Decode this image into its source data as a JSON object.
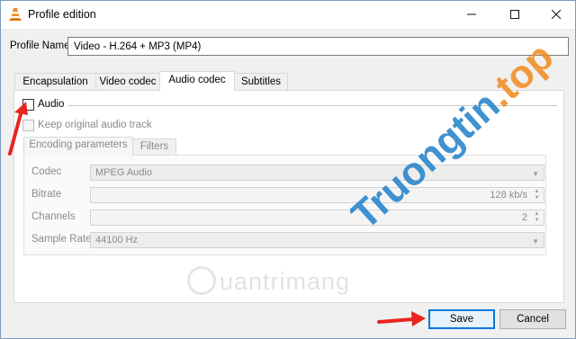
{
  "window": {
    "title": "Profile edition",
    "icons": {
      "app": "vlc-cone-icon",
      "minimize": "minimize-icon",
      "maximize": "maximize-icon",
      "close": "close-icon"
    }
  },
  "profile": {
    "label": "Profile Name",
    "value": "Video - H.264 + MP3 (MP4)"
  },
  "tabs": [
    {
      "label": "Encapsulation",
      "active": false
    },
    {
      "label": "Video codec",
      "active": false
    },
    {
      "label": "Audio codec",
      "active": true
    },
    {
      "label": "Subtitles",
      "active": false
    }
  ],
  "audio": {
    "label": "Audio",
    "checked": false,
    "keep_original_label": "Keep original audio track",
    "keep_original_checked": false
  },
  "subtabs": [
    {
      "label": "Encoding parameters",
      "active": true
    },
    {
      "label": "Filters",
      "active": false
    }
  ],
  "fields": {
    "codec": {
      "label": "Codec",
      "value": "MPEG Audio"
    },
    "bitrate": {
      "label": "Bitrate",
      "value": "128 kb/s"
    },
    "channels": {
      "label": "Channels",
      "value": "2"
    },
    "sample_rate": {
      "label": "Sample Rate",
      "value": "44100 Hz"
    }
  },
  "buttons": {
    "save": "Save",
    "cancel": "Cancel"
  },
  "watermarks": {
    "side": "Truongtin.top",
    "bottom": "uantrimang"
  },
  "colors": {
    "annotation_arrow": "#e8251f",
    "watermark_blue": "#1f7fc9",
    "watermark_orange": "#f08a1c",
    "focus_border": "#0078d7"
  }
}
